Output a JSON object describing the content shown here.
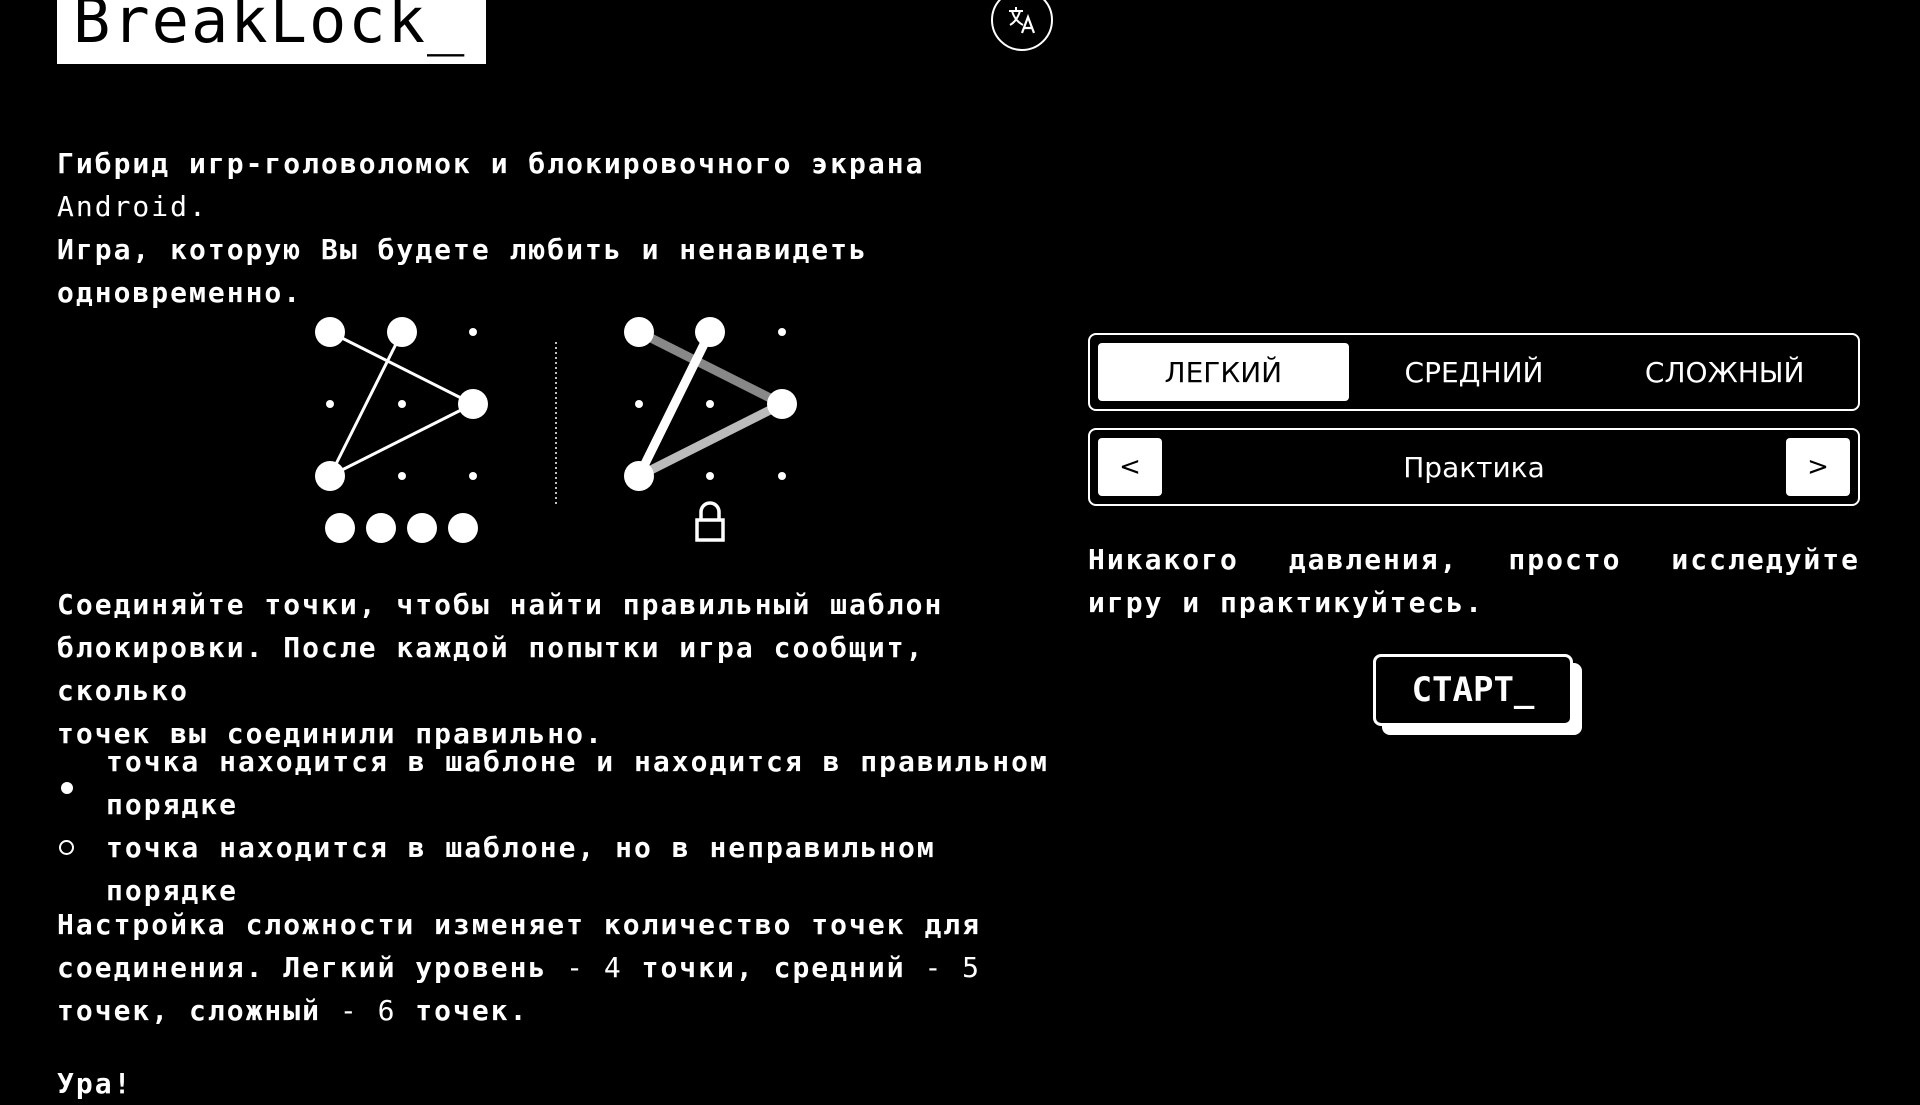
{
  "app": {
    "logo": "BreakLock_",
    "language_icon": "translate-icon"
  },
  "intro": {
    "line1": "Гибрид игр-головоломок и блокировочного экрана ",
    "line1_thin": "Android.",
    "line2": "Игра, которую Вы будете любить и ненавидеть",
    "line3": "одновременно."
  },
  "rules": {
    "line1": "Соединяйте точки, чтобы найти правильный шаблон",
    "line2": "блокировки. После каждой попытки игра сообщит, сколько",
    "line3": "точек вы соединили правильно."
  },
  "legend": {
    "filled_line1": "точка находится в шаблоне и находится в правильном",
    "filled_line2": "порядке",
    "hollow": "точка находится в шаблоне, но в неправильном порядке"
  },
  "difficulty_info": {
    "line1": "Настройка сложности изменяет количество точек для",
    "line2a": "соединения. Легкий уровень ",
    "line2b": "- 4",
    "line2c": " точки, средний ",
    "line2d": "- 5",
    "line3a": "точек, сложный ",
    "line3b": "- 6",
    "line3c": " точек."
  },
  "footer": {
    "hooray": "Ура!"
  },
  "difficulty": {
    "tabs": [
      "ЛЕГКИЙ",
      "СРЕДНИЙ",
      "СЛОЖНЫЙ"
    ],
    "active": "ЛЕГКИЙ"
  },
  "mode": {
    "prev": "<",
    "next": ">",
    "label": "Практика"
  },
  "mode_description": "Никакого давления, просто исследуйте игру и практикуйтесь.",
  "start": {
    "label": "СТАРТ_"
  },
  "illustration": {
    "left_feedback_dots": 4,
    "right_icon": "lock-icon"
  }
}
